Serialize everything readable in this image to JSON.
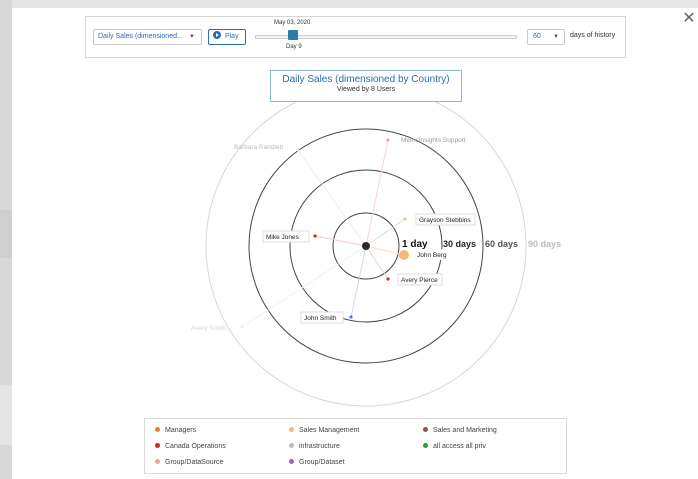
{
  "controls": {
    "metric": "Daily Sales (dimensioned...",
    "play_label": "Play",
    "date": "May 03, 2020",
    "day": "Day 9",
    "history_value": "60",
    "history_label": "days of history"
  },
  "chart": {
    "title": "Daily Sales (dimensioned by Country)",
    "subtitle": "Viewed by 8 Users",
    "rings": [
      "1 day",
      "30 days",
      "60 days",
      "90 days"
    ],
    "users": [
      "Barbara Randlett",
      "MetricInsights Support",
      "Grayson Stebbins",
      "Mike Jones",
      "John Berg",
      "Avery Pierce",
      "John Smith",
      "Avery Smith"
    ]
  },
  "legend": [
    {
      "label": "Managers",
      "color": "#f07f2a"
    },
    {
      "label": "Sales Management",
      "color": "#f5b97a"
    },
    {
      "label": "Sales and Marketing",
      "color": "#8a5846"
    },
    {
      "label": "Canada Operations",
      "color": "#d0252a"
    },
    {
      "label": "infrastructure",
      "color": "#bfbfbf"
    },
    {
      "label": "all access all priv",
      "color": "#2ca02c"
    },
    {
      "label": "Group/DataSource",
      "color": "#f4a09a"
    },
    {
      "label": "Group/Dataset",
      "color": "#9467bd"
    }
  ]
}
